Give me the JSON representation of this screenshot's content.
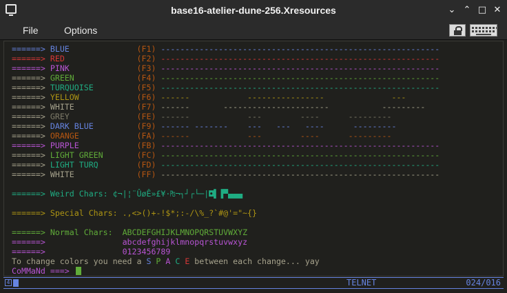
{
  "window": {
    "title": "base16-atelier-dune-256.Xresources",
    "minimize_glyph": "⌄",
    "maximize_glyph": "⌃",
    "restore_glyph": "□",
    "close_glyph": "✕"
  },
  "menu": {
    "file": "File",
    "options": "Options"
  },
  "toolbar": {
    "lock_icon": "lock-icon",
    "keyboard_icon": "keyboard-icon"
  },
  "colors": {
    "arrow": "#a6a28c",
    "blue": "#6684e1",
    "red": "#d73737",
    "pink": "#b854d4",
    "green": "#60ac39",
    "turquoise": "#1fad83",
    "yellow": "#ae9513",
    "white": "#a6a28c",
    "grey": "#7d7a68",
    "orange": "#b65611",
    "purple": "#b854d4",
    "light_green": "#60ac39",
    "light_turq": "#1fad83",
    "fkey": "#b65611"
  },
  "terminal": {
    "arrow": "======>",
    "color_rows": [
      {
        "name": "BLUE",
        "key": "(F1)",
        "dashes": "----------------------------------------------------------",
        "color": "#6684e1",
        "arrow_color": "#6684e1"
      },
      {
        "name": "RED",
        "key": "(F2)",
        "dashes": "----------------------------------------------------------",
        "color": "#d73737",
        "arrow_color": "#d73737"
      },
      {
        "name": "PINK",
        "key": "(F3)",
        "dashes": "----------------------------------------------------------",
        "color": "#b854d4",
        "arrow_color": "#b854d4"
      },
      {
        "name": "GREEN",
        "key": "(F4)",
        "dashes": "----------------------------------------------------------",
        "color": "#60ac39",
        "arrow_color": "#a6a28c"
      },
      {
        "name": "TURQUOISE",
        "key": "(F5)",
        "dashes": "----------------------------------------------------------",
        "color": "#1fad83",
        "arrow_color": "#a6a28c"
      },
      {
        "name": "YELLOW",
        "key": "(F6)",
        "dashes": "------            ----------------              ---",
        "color": "#ae9513",
        "arrow_color": "#a6a28c"
      },
      {
        "name": "WHITE",
        "key": "(F7)",
        "dashes": "------       ----------------------           ---------",
        "color": "#a6a28c",
        "arrow_color": "#a6a28c"
      },
      {
        "name": "GREY",
        "key": "(FE)",
        "dashes": "------            ---        ----      ---------",
        "color": "#7d7a68",
        "arrow_color": "#a6a28c"
      },
      {
        "name": "DARK BLUE",
        "key": "(F9)",
        "dashes": "------ -------    ---   ---   ----      ---------",
        "color": "#6684e1",
        "arrow_color": "#a6a28c"
      },
      {
        "name": "ORANGE",
        "key": "(FA)",
        "dashes": "------            ---        ----      ---------",
        "color": "#b65611",
        "arrow_color": "#a6a28c"
      },
      {
        "name": "PURPLE",
        "key": "(FB)",
        "dashes": "----------------------------------------------------------",
        "color": "#b854d4",
        "arrow_color": "#b854d4"
      },
      {
        "name": "LIGHT GREEN",
        "key": "(FC)",
        "dashes": "----------------------------------------------------------",
        "color": "#60ac39",
        "arrow_color": "#a6a28c"
      },
      {
        "name": "LIGHT TURQ",
        "key": "(FD)",
        "dashes": "----------------------------------------------------------",
        "color": "#1fad83",
        "arrow_color": "#a6a28c"
      },
      {
        "name": "WHITE",
        "key": "(FF)",
        "dashes": "----------------------------------------------------------",
        "color": "#a6a28c",
        "arrow_color": "#a6a28c"
      }
    ],
    "weird_label": "Weird Chars:",
    "weird_chars": "¢¬|¦¨ÛøÊ»£¥·₧¬┐┘┌└─|◘▌▐▀▄▄▄",
    "special_label": "Special Chars:",
    "special_chars": ".,<>()+-!$*;:-/\\%_?`#@'=\"~{}",
    "normal_label": "Normal Chars:",
    "upper_chars": "ABCDEFGHIJKLMNOPQRSTUVWXYZ",
    "lower_chars": "abcdefghijklmnopqrstuvwxyz",
    "digit_chars": "0123456789",
    "info_prefix": "To change colors you need a ",
    "info_space": [
      "S",
      "P",
      "A",
      "C",
      "E"
    ],
    "info_suffix": " between each change... yay",
    "prompt": "CoMMaNd ===>"
  },
  "status": {
    "mode": "TELNET",
    "position": "024/016"
  }
}
